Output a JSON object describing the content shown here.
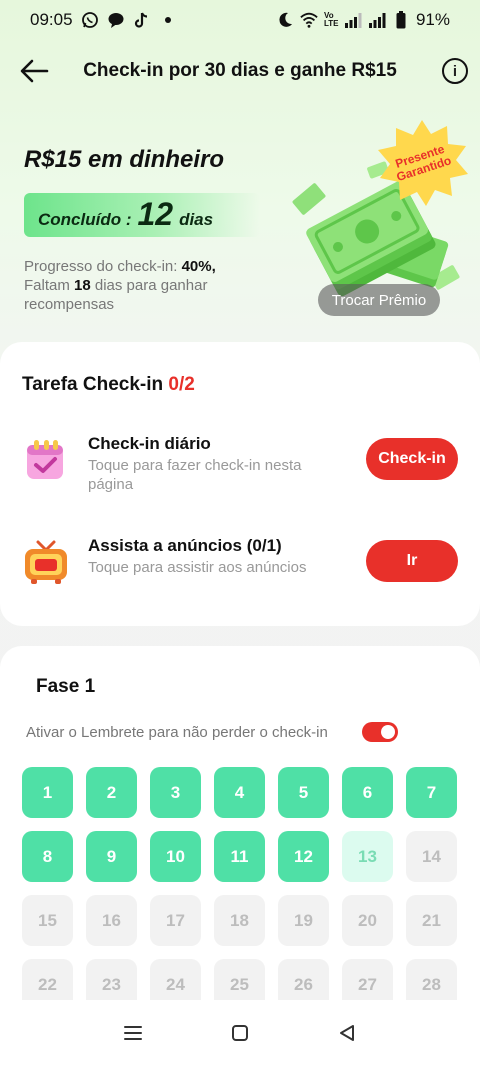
{
  "status": {
    "time": "09:05",
    "battery": "91%",
    "volte": "Vo LTE"
  },
  "header": {
    "title": "Check-in por 30 dias e ganhe R$15",
    "info": "i"
  },
  "reward": {
    "title": "R$15 em dinheiro",
    "done_label": "Concluído :",
    "done_days": "12",
    "done_unit": "dias",
    "progress_prefix": "Progresso do check-in:",
    "progress_value": "40%,",
    "remaining_prefix": "Faltam",
    "remaining_days": "18",
    "remaining_suffix": "dias para ganhar recompensas",
    "badge_line1": "Presente",
    "badge_line2": "Garantido",
    "swap_label": "Trocar Prêmio"
  },
  "tasks": {
    "title": "Tarefa Check-in",
    "count": "0/2",
    "items": [
      {
        "name": "Check-in diário",
        "desc": "Toque para fazer check-in nesta página",
        "button": "Check-in",
        "icon": "calendar-check-icon"
      },
      {
        "name": "Assista a anúncios  (0/1)",
        "desc": "Toque para assistir aos anúncios",
        "button": "Ir",
        "icon": "ad-tv-icon"
      }
    ]
  },
  "phase": {
    "title": "Fase 1",
    "reminder": "Ativar o Lembrete para não perder o check-in",
    "reminder_on": true,
    "days": [
      "1",
      "2",
      "3",
      "4",
      "5",
      "6",
      "7",
      "8",
      "9",
      "10",
      "11",
      "12",
      "13",
      "14",
      "15",
      "16",
      "17",
      "18",
      "19",
      "20",
      "21",
      "22",
      "23",
      "24",
      "25",
      "26",
      "27",
      "28"
    ],
    "completed_days": 12,
    "today": 13
  },
  "colors": {
    "accent": "#e8302a",
    "done": "#4fe0a6",
    "today": "#dcfbef",
    "future": "#f2f2f2"
  }
}
